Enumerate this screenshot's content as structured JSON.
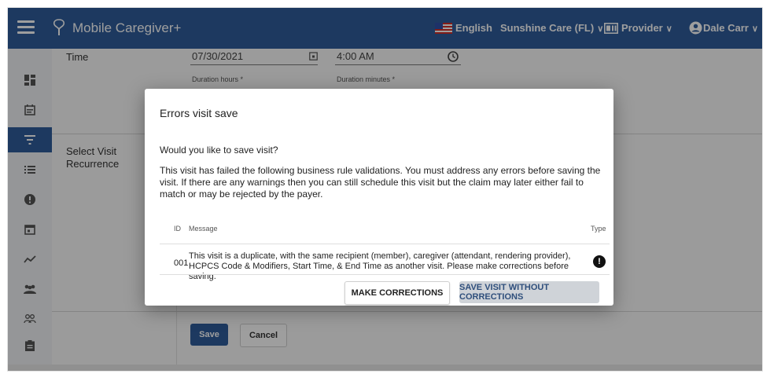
{
  "app": {
    "title": "Mobile Caregiver+",
    "language": "English",
    "agency": "Sunshine Care (FL)",
    "role": "Provider",
    "user": "Dale Carr"
  },
  "sidebar": {
    "items": [
      {
        "icon": "dashboard-icon",
        "active": false
      },
      {
        "icon": "calendar-note-icon",
        "active": false
      },
      {
        "icon": "filter-icon",
        "active": true
      },
      {
        "icon": "list-icon",
        "active": false
      },
      {
        "icon": "alert-icon",
        "active": false
      },
      {
        "icon": "calendar-icon",
        "active": false
      },
      {
        "icon": "trend-icon",
        "active": false
      },
      {
        "icon": "group-icon",
        "active": false
      },
      {
        "icon": "people-outline-icon",
        "active": false
      },
      {
        "icon": "clipboard-icon",
        "active": false
      }
    ]
  },
  "form": {
    "time_label": "Time",
    "date_value": "07/30/2021",
    "time_value": "4:00 AM",
    "duration_hours_label": "Duration hours *",
    "duration_minutes_label": "Duration minutes *",
    "recurrence_label": "Select Visit Recurrence",
    "save_label": "Save",
    "cancel_label": "Cancel"
  },
  "modal": {
    "title": "Errors visit save",
    "question": "Would you like to save visit?",
    "body": "This visit has failed the following business rule validations. You must address any errors before saving the visit. If there are any warnings then you can still schedule this visit but the claim may later either fail to match or may be rejected by the payer.",
    "columns": {
      "id": "ID",
      "message": "Message",
      "type": "Type"
    },
    "rows": [
      {
        "id": "001",
        "message": "This visit is a duplicate, with the same recipient (member), caregiver (attendant, rendering provider), HCPCS Code & Modifiers, Start Time, & End Time as another visit. Please make corrections before saving.",
        "type": "!"
      }
    ],
    "make_corrections_label": "MAKE CORRECTIONS",
    "save_without_label": "SAVE VISIT WITHOUT CORRECTIONS"
  },
  "colors": {
    "primary": "#2f5d9c",
    "overlay": "rgba(0,0,0,0.38)"
  }
}
